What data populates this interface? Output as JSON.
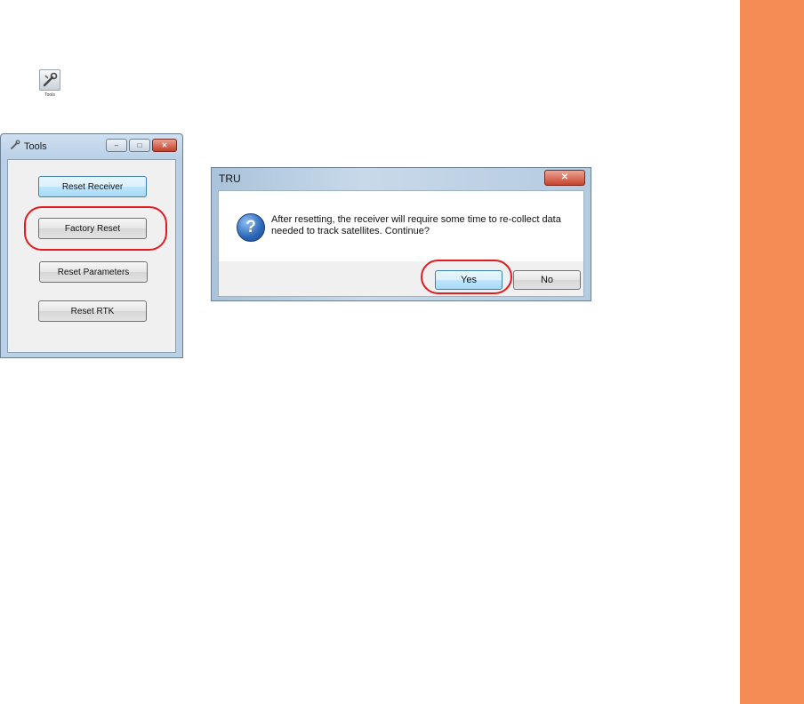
{
  "shortcut": {
    "label": "Tools",
    "icon": "tools-wrench-icon"
  },
  "tools_window": {
    "title": "Tools",
    "controls": {
      "minimize": "–",
      "maximize": "□",
      "close": "✕"
    },
    "buttons": {
      "reset_receiver": "Reset Receiver",
      "factory_reset": "Factory Reset",
      "reset_parameters": "Reset Parameters",
      "reset_rtk": "Reset RTK"
    }
  },
  "dialog": {
    "title": "TRU",
    "close": "✕",
    "icon": "question-icon",
    "message": "After resetting, the receiver will require some time to re-collect data needed to track satellites. Continue?",
    "yes_label": "Yes",
    "no_label": "No"
  },
  "colors": {
    "side_band": "#F58B55",
    "highlight_ring": "#E11B22"
  }
}
